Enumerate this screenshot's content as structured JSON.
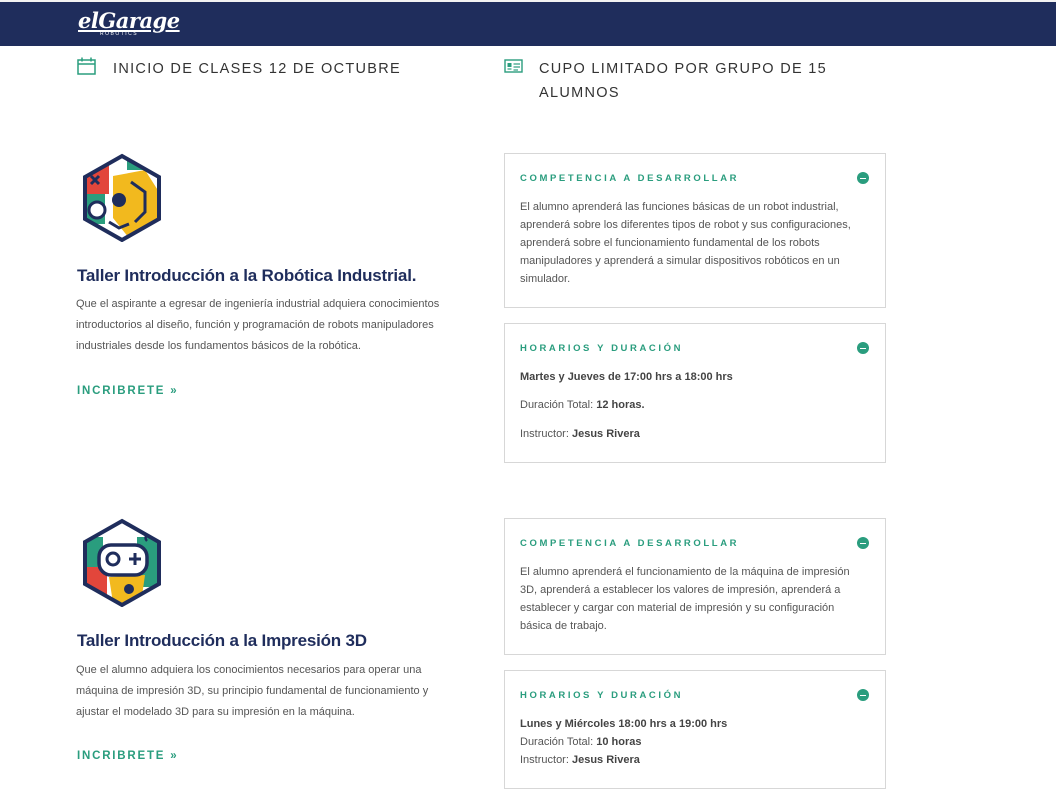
{
  "header": {
    "logo_text": "elGarage",
    "logo_sub": "ROBOTICS"
  },
  "info": {
    "start_text": "INICIO DE CLASES 12 DE OCTUBRE",
    "cupo_line1": "CUPO LIMITADO POR GRUPO DE 15",
    "cupo_line2": "ALUMNOS",
    "start_icon": "calendar-icon",
    "cupo_icon": "id-card-icon"
  },
  "colors": {
    "navy": "#1f2d5c",
    "teal": "#2a9d7e"
  },
  "courses": [
    {
      "title": "Taller Introducción a la Robótica Industrial.",
      "description": "Que el aspirante a egresar de ingeniería industrial adquiera conocimientos introductorios al diseño, función y programación de robots manipuladores industriales desde los fundamentos básicos de la robótica.",
      "cta": "INCRIBRETE »",
      "icon": "robot-arm-hexagon-icon",
      "competencia": {
        "title": "COMPETENCIA A DESARROLLAR",
        "text": "El alumno aprenderá las funciones básicas de un robot industrial, aprenderá sobre los diferentes tipos de robot y sus configuraciones, aprenderá sobre el funcionamiento fundamental de los robots manipuladores y aprenderá a simular dispositivos robóticos en un simulador."
      },
      "horarios": {
        "title": "HORARIOS Y DURACIÓN",
        "schedule": "Martes y Jueves de 17:00 hrs a 18:00 hrs",
        "duration_label": "Duración Total:",
        "duration_value": "12 horas.",
        "instructor_label": "Instructor:",
        "instructor_value": "Jesus Rivera"
      }
    },
    {
      "title": "Taller Introducción a la Impresión 3D",
      "description": "Que el alumno adquiera los conocimientos necesarios para operar una máquina de impresión 3D, su principio fundamental de funcionamiento y ajustar el modelado 3D para su impresión en la máquina.",
      "cta": "INCRIBRETE »",
      "icon": "gamepad-hexagon-icon",
      "competencia": {
        "title": "COMPETENCIA A DESARROLLAR",
        "text": "El alumno aprenderá el funcionamiento de la máquina de impresión 3D, aprenderá a establecer los valores de impresión, aprenderá a establecer y cargar con material de impresión y su configuración básica de trabajo."
      },
      "horarios": {
        "title": "HORARIOS Y DURACIÓN",
        "schedule": "Lunes y Miércoles 18:00 hrs a 19:00 hrs",
        "duration_label": "Duración Total:",
        "duration_value": "10 horas",
        "instructor_label": "Instructor:",
        "instructor_value": "Jesus Rivera"
      }
    }
  ]
}
